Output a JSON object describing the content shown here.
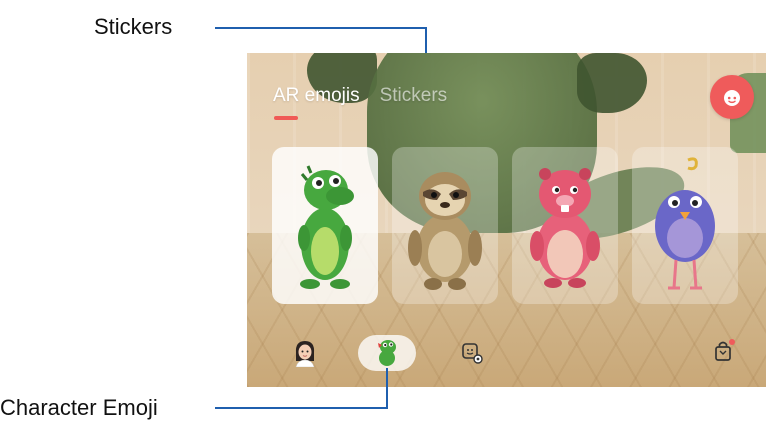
{
  "callouts": {
    "stickers": "Stickers",
    "character_emoji": "Character Emoji"
  },
  "tabs": [
    {
      "label": "AR emojis",
      "active": true
    },
    {
      "label": "Stickers",
      "active": false
    }
  ],
  "emoji_cards": [
    {
      "name": "Dinosaur",
      "selected": true
    },
    {
      "name": "Sloth",
      "selected": false
    },
    {
      "name": "Beaver",
      "selected": false
    },
    {
      "name": "Bird",
      "selected": false
    }
  ],
  "bottom_bar": [
    {
      "icon": "my-emoji-avatar-icon"
    },
    {
      "icon": "character-emoji-icon",
      "selected": true
    },
    {
      "icon": "sticker-gallery-icon"
    },
    {
      "icon": "store-bag-icon",
      "notification_dot": true
    }
  ],
  "colors": {
    "accent": "#ef5b5b",
    "callout_line": "#1f5fae"
  }
}
